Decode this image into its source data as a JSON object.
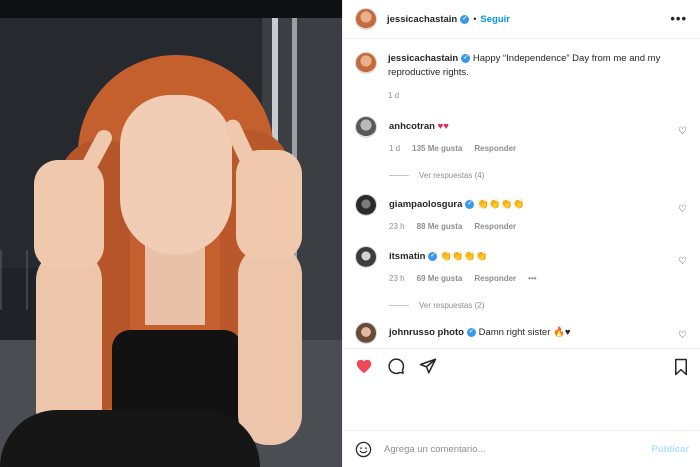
{
  "post": {
    "author": "jessicachastain",
    "follow_label": "Seguir",
    "separator": "•",
    "more_label": "•••",
    "caption": "Happy “Independence” Day from me and my reproductive rights.",
    "caption_time": "1 d"
  },
  "comments": [
    {
      "username": "anhcotran",
      "verified": false,
      "text": "♥♥",
      "time": "1 d",
      "likes": "135 Me gusta",
      "reply_label": "Responder",
      "view_replies": "Ver respuestas (4)"
    },
    {
      "username": "giampaolosgura",
      "verified": true,
      "text": "👏👏👏👏",
      "time": "23 h",
      "likes": "88 Me gusta",
      "reply_label": "Responder"
    },
    {
      "username": "itsmatin",
      "verified": true,
      "text": "👏👏👏👏",
      "time": "23 h",
      "likes": "69 Me gusta",
      "reply_label": "Responder",
      "more_label": "•••",
      "view_replies": "Ver respuestas (2)"
    },
    {
      "username": "johnrusso photo",
      "verified": true,
      "text": "Damn right sister 🔥♥"
    }
  ],
  "add_comment": {
    "placeholder": "Agrega un comentario...",
    "publish_label": "Publicar"
  },
  "colors": {
    "accent": "#0095f6",
    "liked": "#ed4956",
    "verified": "#3897f0"
  }
}
